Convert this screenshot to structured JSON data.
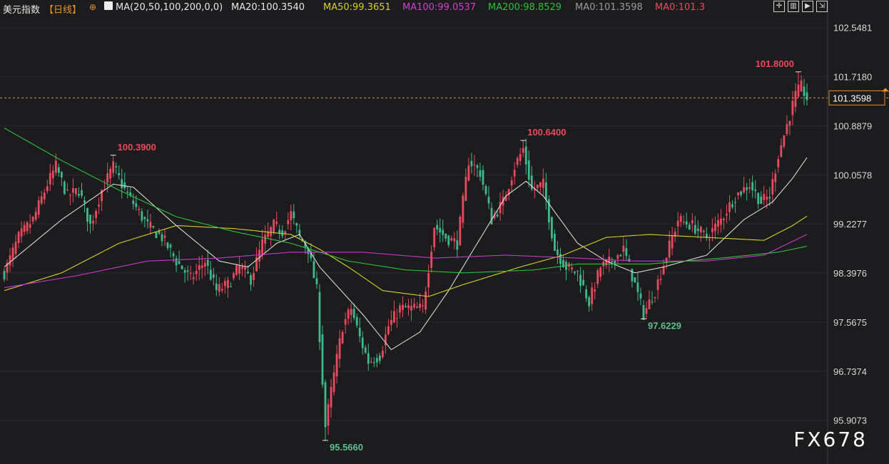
{
  "header": {
    "title": "美元指数",
    "period": "【日线】",
    "indicator": "MA(20,50,100,200,0,0)",
    "ma20": "MA20:100.3540",
    "ma50": "MA50:99.3651",
    "ma100": "MA100:99.0537",
    "ma200": "MA200:98.8529",
    "ma0a": "MA0:101.3598",
    "ma0b": "MA0:101.3"
  },
  "watermark": "FX678",
  "colors": {
    "up": "#e84a5f",
    "down": "#3fb98b",
    "ma20": "#d8d8d8",
    "ma50": "#d6cf2a",
    "ma100": "#c838c8",
    "ma200": "#2fbf3a",
    "price_line": "#e8902a",
    "high_label": "#e84a5f",
    "low_label": "#5fbf8f"
  },
  "chart_data": {
    "type": "candlestick",
    "ylim": [
      95.3,
      102.75
    ],
    "y_ticks": [
      "102.5481",
      "101.7180",
      "100.8879",
      "100.0578",
      "99.2277",
      "98.3976",
      "97.5675",
      "96.7374",
      "95.9073"
    ],
    "current_price": "101.3598",
    "annotations": [
      {
        "label": "100.3900",
        "type": "high",
        "index": 38
      },
      {
        "label": "100.6400",
        "type": "high",
        "index": 181
      },
      {
        "label": "101.8000",
        "type": "high",
        "index": 277
      },
      {
        "label": "95.5660",
        "type": "low",
        "index": 112
      },
      {
        "label": "97.6229",
        "type": "low",
        "index": 223
      }
    ],
    "anchors": [
      [
        0,
        98.4
      ],
      [
        5,
        99.0
      ],
      [
        10,
        99.3
      ],
      [
        15,
        99.9
      ],
      [
        18,
        100.2
      ],
      [
        22,
        99.7
      ],
      [
        26,
        99.8
      ],
      [
        30,
        99.2
      ],
      [
        34,
        99.8
      ],
      [
        38,
        100.2
      ],
      [
        42,
        99.8
      ],
      [
        46,
        99.5
      ],
      [
        50,
        99.2
      ],
      [
        55,
        99.0
      ],
      [
        60,
        98.6
      ],
      [
        65,
        98.3
      ],
      [
        70,
        98.6
      ],
      [
        74,
        98.1
      ],
      [
        78,
        98.2
      ],
      [
        82,
        98.5
      ],
      [
        86,
        98.3
      ],
      [
        90,
        98.9
      ],
      [
        94,
        99.2
      ],
      [
        97,
        99.1
      ],
      [
        100,
        99.4
      ],
      [
        103,
        99.0
      ],
      [
        106,
        98.8
      ],
      [
        109,
        98.1
      ],
      [
        112,
        95.8
      ],
      [
        114,
        96.4
      ],
      [
        118,
        97.5
      ],
      [
        121,
        97.8
      ],
      [
        124,
        97.3
      ],
      [
        127,
        96.9
      ],
      [
        131,
        97.0
      ],
      [
        134,
        97.5
      ],
      [
        138,
        97.8
      ],
      [
        142,
        97.8
      ],
      [
        146,
        97.8
      ],
      [
        150,
        99.2
      ],
      [
        154,
        99.0
      ],
      [
        158,
        98.9
      ],
      [
        162,
        100.3
      ],
      [
        166,
        100.1
      ],
      [
        170,
        99.3
      ],
      [
        174,
        99.6
      ],
      [
        178,
        100.2
      ],
      [
        181,
        100.5
      ],
      [
        184,
        99.8
      ],
      [
        188,
        99.9
      ],
      [
        192,
        98.8
      ],
      [
        196,
        98.5
      ],
      [
        200,
        98.4
      ],
      [
        204,
        97.9
      ],
      [
        208,
        98.5
      ],
      [
        212,
        98.6
      ],
      [
        216,
        98.8
      ],
      [
        220,
        98.2
      ],
      [
        223,
        97.7
      ],
      [
        227,
        98.1
      ],
      [
        231,
        98.7
      ],
      [
        235,
        99.3
      ],
      [
        240,
        99.2
      ],
      [
        245,
        99.0
      ],
      [
        250,
        99.3
      ],
      [
        255,
        99.7
      ],
      [
        260,
        99.9
      ],
      [
        264,
        99.6
      ],
      [
        267,
        99.7
      ],
      [
        270,
        100.4
      ],
      [
        273,
        100.9
      ],
      [
        276,
        101.4
      ],
      [
        278,
        101.55
      ],
      [
        280,
        101.35
      ]
    ],
    "moving_averages": [
      {
        "name": "MA20",
        "points": [
          [
            0,
            98.5
          ],
          [
            20,
            99.3
          ],
          [
            38,
            99.9
          ],
          [
            45,
            99.85
          ],
          [
            60,
            99.2
          ],
          [
            75,
            98.6
          ],
          [
            85,
            98.5
          ],
          [
            95,
            98.9
          ],
          [
            103,
            99.05
          ],
          [
            110,
            98.5
          ],
          [
            125,
            97.7
          ],
          [
            135,
            97.1
          ],
          [
            145,
            97.4
          ],
          [
            155,
            98.1
          ],
          [
            165,
            98.9
          ],
          [
            175,
            99.7
          ],
          [
            182,
            99.95
          ],
          [
            188,
            99.7
          ],
          [
            200,
            98.9
          ],
          [
            210,
            98.6
          ],
          [
            220,
            98.4
          ],
          [
            230,
            98.5
          ],
          [
            245,
            98.7
          ],
          [
            258,
            99.3
          ],
          [
            268,
            99.6
          ],
          [
            275,
            100.0
          ],
          [
            280,
            100.35
          ]
        ]
      },
      {
        "name": "MA50",
        "points": [
          [
            0,
            98.1
          ],
          [
            20,
            98.4
          ],
          [
            40,
            98.9
          ],
          [
            60,
            99.2
          ],
          [
            80,
            99.15
          ],
          [
            100,
            99.05
          ],
          [
            110,
            98.8
          ],
          [
            120,
            98.5
          ],
          [
            132,
            98.1
          ],
          [
            148,
            98.0
          ],
          [
            160,
            98.2
          ],
          [
            180,
            98.5
          ],
          [
            195,
            98.7
          ],
          [
            210,
            99.0
          ],
          [
            225,
            99.05
          ],
          [
            245,
            99.0
          ],
          [
            265,
            98.95
          ],
          [
            275,
            99.2
          ],
          [
            280,
            99.36
          ]
        ]
      },
      {
        "name": "MA100",
        "points": [
          [
            0,
            98.15
          ],
          [
            25,
            98.35
          ],
          [
            50,
            98.6
          ],
          [
            75,
            98.65
          ],
          [
            100,
            98.75
          ],
          [
            125,
            98.75
          ],
          [
            150,
            98.65
          ],
          [
            175,
            98.7
          ],
          [
            200,
            98.65
          ],
          [
            220,
            98.6
          ],
          [
            245,
            98.6
          ],
          [
            265,
            98.7
          ],
          [
            280,
            99.05
          ]
        ]
      },
      {
        "name": "MA200",
        "points": [
          [
            0,
            100.85
          ],
          [
            20,
            100.3
          ],
          [
            40,
            99.8
          ],
          [
            60,
            99.35
          ],
          [
            80,
            99.1
          ],
          [
            100,
            98.9
          ],
          [
            120,
            98.6
          ],
          [
            140,
            98.45
          ],
          [
            160,
            98.4
          ],
          [
            185,
            98.45
          ],
          [
            200,
            98.55
          ],
          [
            225,
            98.55
          ],
          [
            250,
            98.65
          ],
          [
            270,
            98.75
          ],
          [
            280,
            98.85
          ]
        ]
      }
    ]
  }
}
